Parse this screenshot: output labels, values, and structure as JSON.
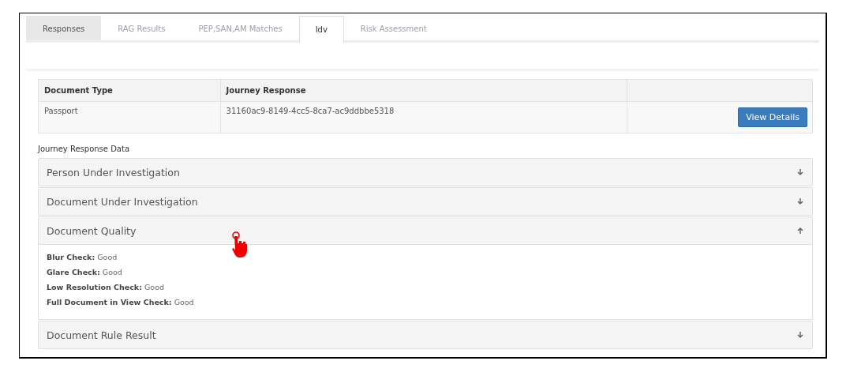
{
  "tabs": [
    {
      "label": "Responses",
      "selected": false,
      "hovered": true
    },
    {
      "label": "RAG Results",
      "selected": false,
      "hovered": false
    },
    {
      "label": "PEP,SAN,AM Matches",
      "selected": false,
      "hovered": false
    },
    {
      "label": "Idv",
      "selected": true,
      "hovered": false
    },
    {
      "label": "Risk Assessment",
      "selected": false,
      "hovered": false
    }
  ],
  "table": {
    "columns": [
      "Document Type",
      "Journey Response"
    ],
    "rows": [
      {
        "cells": [
          "Passport",
          "31160ac9-8149-4cc5-8ca7-ac9ddbbe5318"
        ],
        "button": "View Details"
      }
    ]
  },
  "section_title": "Journey Response Data",
  "panels": [
    {
      "title": "Person Under Investigation",
      "expanded": false
    },
    {
      "title": "Document Under Investigation",
      "expanded": false
    },
    {
      "title": "Document Quality",
      "expanded": true,
      "fields": [
        {
          "label": "Blur Check:",
          "value": "Good"
        },
        {
          "label": "Glare Check:",
          "value": "Good"
        },
        {
          "label": "Low Resolution Check:",
          "value": "Good"
        },
        {
          "label": "Full Document in View Check:",
          "value": "Good"
        }
      ]
    },
    {
      "title": "Document Rule Result",
      "expanded": false
    }
  ]
}
